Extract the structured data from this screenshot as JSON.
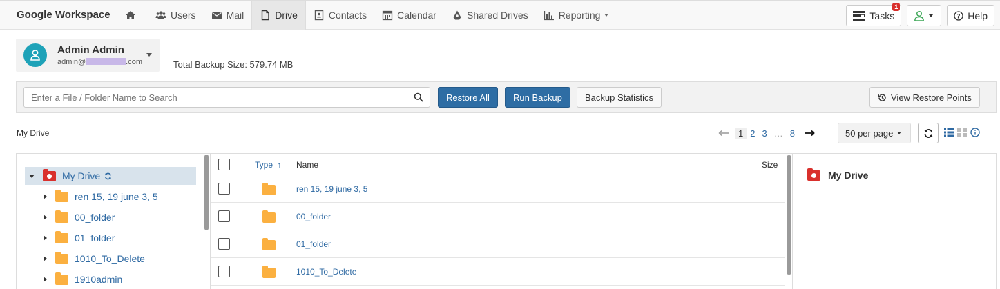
{
  "brand": "Google Workspace",
  "nav": {
    "items": [
      {
        "label": "",
        "icon": "home-icon"
      },
      {
        "label": "Users",
        "icon": "users-icon"
      },
      {
        "label": "Mail",
        "icon": "envelope-icon"
      },
      {
        "label": "Drive",
        "icon": "file-icon",
        "active": true
      },
      {
        "label": "Contacts",
        "icon": "contact-card-icon"
      },
      {
        "label": "Calendar",
        "icon": "calendar-icon"
      },
      {
        "label": "Shared Drives",
        "icon": "cloud-icon"
      },
      {
        "label": "Reporting",
        "icon": "bar-chart-icon"
      }
    ],
    "tasks_label": "Tasks",
    "tasks_badge": "1",
    "help_label": "Help"
  },
  "user": {
    "name": "Admin Admin",
    "email_prefix": "admin@",
    "email_suffix": ".com"
  },
  "backup_size": "Total Backup Size: 579.74 MB",
  "toolbar": {
    "search_placeholder": "Enter a File / Folder Name to Search",
    "restore_all": "Restore All",
    "run_backup": "Run Backup",
    "backup_statistics": "Backup Statistics",
    "view_restore_points": "View Restore Points"
  },
  "breadcrumb": "My Drive",
  "pagination": {
    "pages": [
      "1",
      "2",
      "3",
      "…",
      "8"
    ],
    "current": "1",
    "per_page": "50 per page"
  },
  "tree": {
    "root": "My Drive",
    "items": [
      "ren 15, 19 june 3, 5",
      "00_folder",
      "01_folder",
      "1010_To_Delete",
      "1910admin"
    ]
  },
  "list": {
    "columns": {
      "type": "Type",
      "name": "Name",
      "size": "Size"
    },
    "sort_indicator": "↑",
    "rows": [
      {
        "name": "ren 15, 19 june 3, 5"
      },
      {
        "name": "00_folder"
      },
      {
        "name": "01_folder"
      },
      {
        "name": "1010_To_Delete"
      }
    ]
  },
  "details": {
    "title": "My Drive"
  },
  "colors": {
    "primary": "#2e6da4",
    "link": "#2f6aa3",
    "folder": "#fbb040",
    "drive_red": "#d9302c",
    "avatar": "#1ea2b8"
  }
}
